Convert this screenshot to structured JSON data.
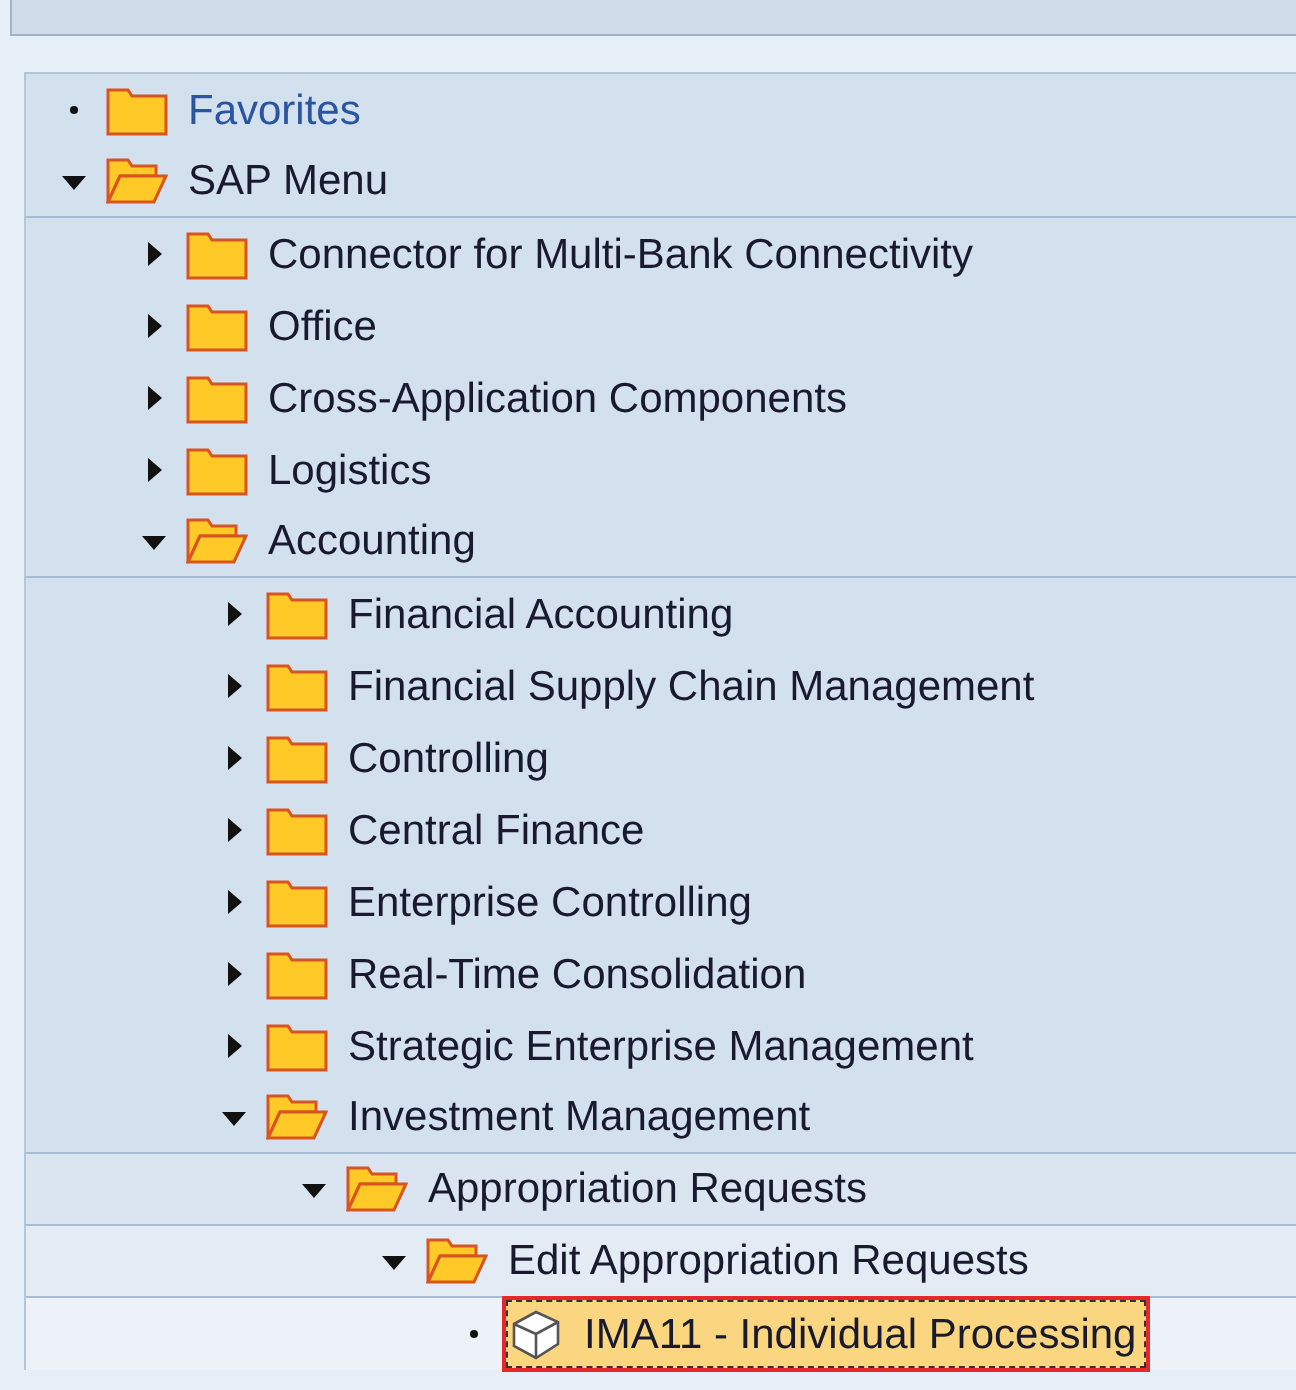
{
  "tree": [
    {
      "label": "Favorites",
      "kind": "favorites",
      "expandable": false,
      "selected": false
    },
    {
      "label": "SAP Menu",
      "kind": "folder",
      "expandable": true,
      "expanded": true,
      "selected": false,
      "children": [
        {
          "label": "Connector for Multi-Bank Connectivity",
          "kind": "folder",
          "expandable": true,
          "expanded": false,
          "selected": false
        },
        {
          "label": "Office",
          "kind": "folder",
          "expandable": true,
          "expanded": false,
          "selected": false
        },
        {
          "label": "Cross-Application Components",
          "kind": "folder",
          "expandable": true,
          "expanded": false,
          "selected": false
        },
        {
          "label": "Logistics",
          "kind": "folder",
          "expandable": true,
          "expanded": false,
          "selected": false
        },
        {
          "label": "Accounting",
          "kind": "folder",
          "expandable": true,
          "expanded": true,
          "selected": false,
          "children": [
            {
              "label": "Financial Accounting",
              "kind": "folder",
              "expandable": true,
              "expanded": false,
              "selected": false
            },
            {
              "label": "Financial Supply Chain Management",
              "kind": "folder",
              "expandable": true,
              "expanded": false,
              "selected": false
            },
            {
              "label": "Controlling",
              "kind": "folder",
              "expandable": true,
              "expanded": false,
              "selected": false
            },
            {
              "label": "Central Finance",
              "kind": "folder",
              "expandable": true,
              "expanded": false,
              "selected": false
            },
            {
              "label": "Enterprise Controlling",
              "kind": "folder",
              "expandable": true,
              "expanded": false,
              "selected": false
            },
            {
              "label": "Real-Time Consolidation",
              "kind": "folder",
              "expandable": true,
              "expanded": false,
              "selected": false
            },
            {
              "label": "Strategic Enterprise Management",
              "kind": "folder",
              "expandable": true,
              "expanded": false,
              "selected": false
            },
            {
              "label": "Investment Management",
              "kind": "folder",
              "expandable": true,
              "expanded": true,
              "selected": false,
              "children": [
                {
                  "label": "Appropriation Requests",
                  "kind": "folder",
                  "expandable": true,
                  "expanded": true,
                  "selected": false,
                  "children": [
                    {
                      "label": "Edit Appropriation Requests",
                      "kind": "folder",
                      "expandable": true,
                      "expanded": true,
                      "selected": false,
                      "children": [
                        {
                          "label": "IMA11 - Individual Processing",
                          "kind": "transaction",
                          "expandable": false,
                          "selected": true
                        }
                      ]
                    }
                  ]
                }
              ]
            }
          ]
        }
      ]
    }
  ]
}
